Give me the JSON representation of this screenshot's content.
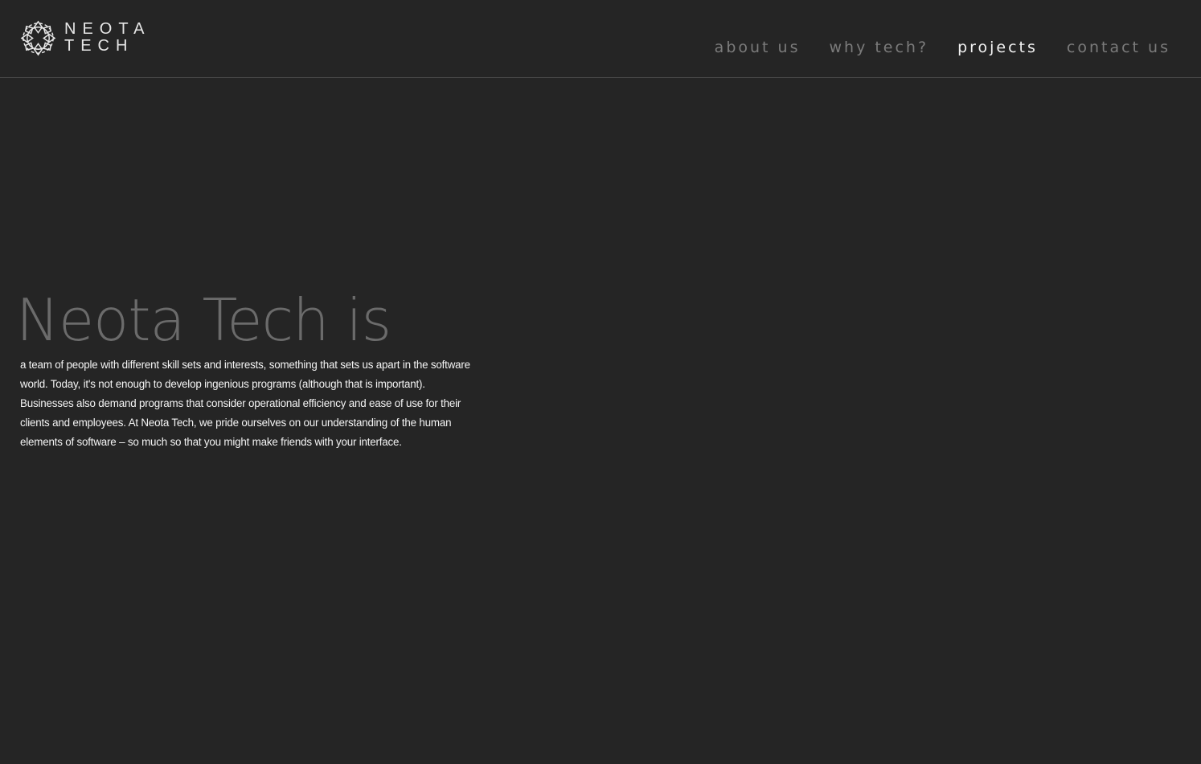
{
  "brand": {
    "logo_line1": "NEOTA",
    "logo_line2": "TECH",
    "logo_icon": "geometric-flower-logo-icon"
  },
  "nav": {
    "items": [
      {
        "label": "about us",
        "active": false
      },
      {
        "label": "why tech?",
        "active": false
      },
      {
        "label": "projects",
        "active": true
      },
      {
        "label": "contact us",
        "active": false
      }
    ]
  },
  "hero": {
    "title": "Neota Tech is",
    "body": "a team of people with different skill sets and interests, something that sets us apart in the software world. Today, it's not enough to develop ingenious programs (although that is important). Businesses also demand programs that consider operational efficiency and ease of use for their clients and employees. At Neota Tech, we pride ourselves on our understanding of the human elements of software – so much so that you might make friends with your interface."
  },
  "colors": {
    "background": "#252525",
    "nav_inactive": "#7b7b7b",
    "nav_active": "#f2f2f2",
    "title": "#6b6b6b",
    "body_text": "#f4f4f4",
    "divider": "#4a4a4a"
  }
}
